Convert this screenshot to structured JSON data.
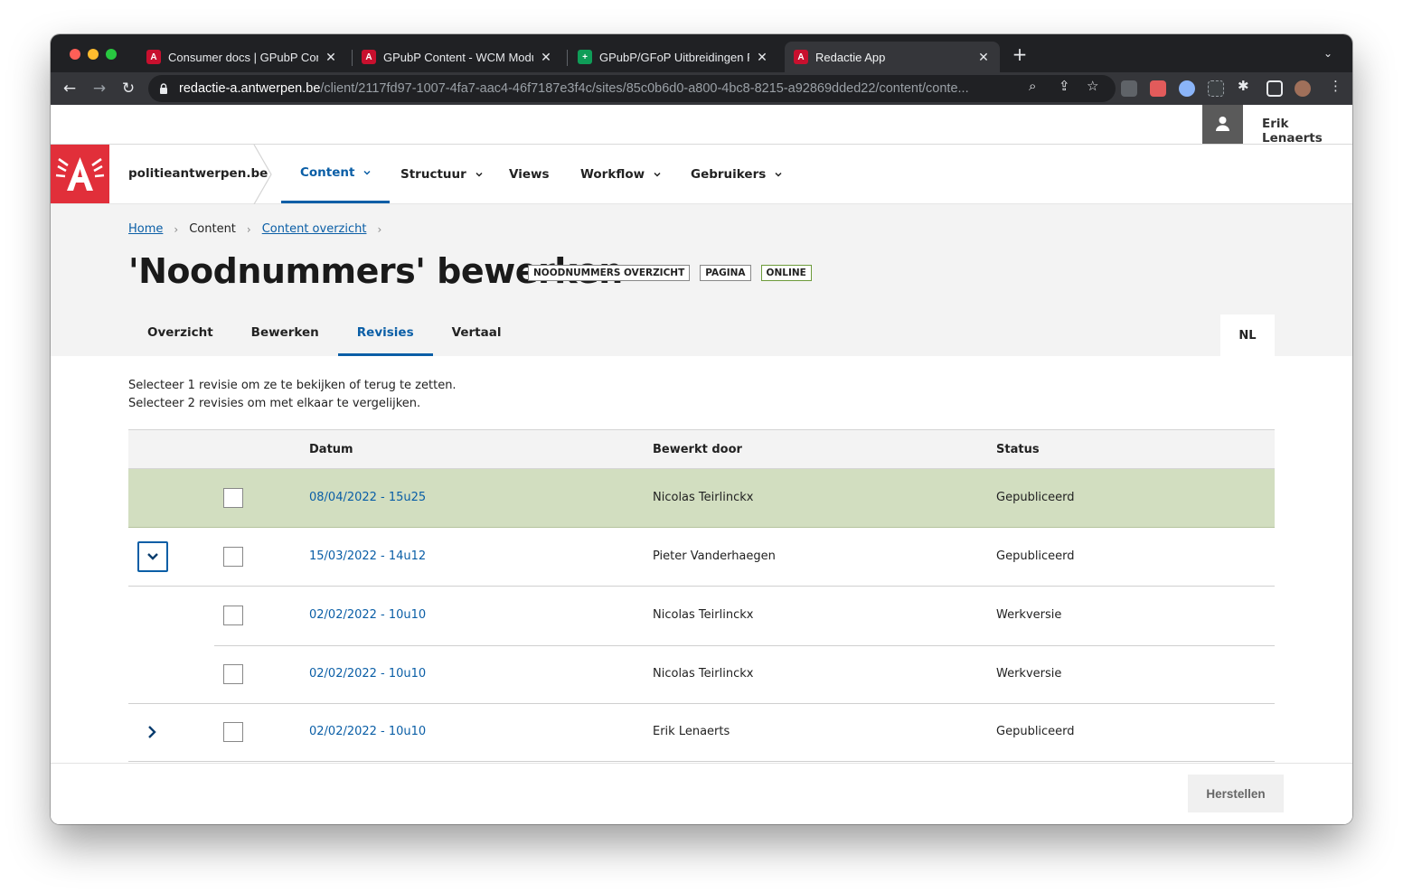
{
  "browser": {
    "tabs": [
      {
        "title": "Consumer docs | GPubP Conte",
        "favicon": "antwerpen-a-icon",
        "active": false
      },
      {
        "title": "GPubP Content - WCM Module",
        "favicon": "antwerpen-a-icon",
        "active": false
      },
      {
        "title": "GPubP/GFoP Uitbreidingen PZA",
        "favicon": "sheets-icon",
        "active": false
      },
      {
        "title": "Redactie App",
        "favicon": "antwerpen-a-icon",
        "active": true
      }
    ],
    "url_host": "redactie-a.antwerpen.be",
    "url_path": "/client/2117fd97-1007-4fa7-aac4-46f7187e3f4c/sites/85c0b6d0-a800-4bc8-8215-a92869dded22/content/conte..."
  },
  "user": {
    "name": "Erik Lenaerts"
  },
  "site": {
    "name": "politieantwerpen.be",
    "brand_color": "#e12f3a",
    "accent_color": "#0a5ea6"
  },
  "nav": {
    "items": [
      {
        "label": "Content",
        "has_dropdown": true,
        "active": true
      },
      {
        "label": "Structuur",
        "has_dropdown": true,
        "active": false
      },
      {
        "label": "Views",
        "has_dropdown": false,
        "active": false
      },
      {
        "label": "Workflow",
        "has_dropdown": true,
        "active": false
      },
      {
        "label": "Gebruikers",
        "has_dropdown": true,
        "active": false
      }
    ]
  },
  "breadcrumb": [
    {
      "label": "Home",
      "link": true
    },
    {
      "label": "Content",
      "link": false
    },
    {
      "label": "Content overzicht",
      "link": true
    }
  ],
  "page": {
    "title": "'Noodnummers' bewerken",
    "badges": [
      "NOODNUMMERS OVERZICHT",
      "PAGINA",
      "ONLINE"
    ]
  },
  "subtabs": [
    {
      "label": "Overzicht",
      "active": false
    },
    {
      "label": "Bewerken",
      "active": false
    },
    {
      "label": "Revisies",
      "active": true
    },
    {
      "label": "Vertaal",
      "active": false
    }
  ],
  "language": "NL",
  "instructions": {
    "line1": "Selecteer 1 revisie om ze te bekijken of terug te zetten.",
    "line2": "Selecteer 2 revisies om met elkaar te vergelijken."
  },
  "table": {
    "columns": [
      "Datum",
      "Bewerkt door",
      "Status"
    ],
    "rows": [
      {
        "date": "08/04/2022 - 15u25",
        "author": "Nicolas Teirlinckx",
        "status": "Gepubliceerd",
        "highlight": true,
        "control": "none"
      },
      {
        "date": "15/03/2022 - 14u12",
        "author": "Pieter Vanderhaegen",
        "status": "Gepubliceerd",
        "highlight": false,
        "control": "expanded"
      },
      {
        "date": "02/02/2022 - 10u10",
        "author": "Nicolas Teirlinckx",
        "status": "Werkversie",
        "highlight": false,
        "control": "child"
      },
      {
        "date": "02/02/2022 - 10u10",
        "author": "Nicolas Teirlinckx",
        "status": "Werkversie",
        "highlight": false,
        "control": "none"
      },
      {
        "date": "02/02/2022 - 10u10",
        "author": "Erik Lenaerts",
        "status": "Gepubliceerd",
        "highlight": false,
        "control": "collapsed"
      }
    ]
  },
  "actions": {
    "restore_label": "Herstellen"
  }
}
